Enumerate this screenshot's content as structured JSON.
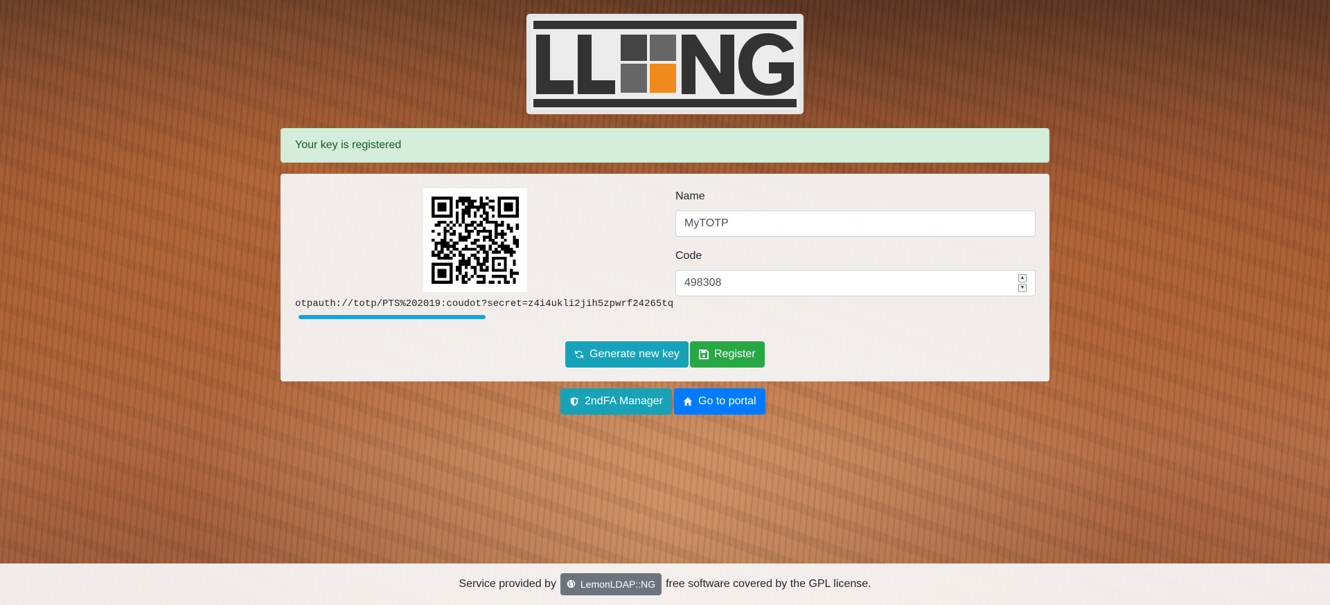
{
  "logo": {
    "text": "LLNG",
    "alt": "LemonLDAP::NG logo"
  },
  "alert": {
    "message": "Your key is registered"
  },
  "totp": {
    "otpauth_uri": "otpauth://totp/PTS%202019:coudot?secret=z4i4ukli2jih5zpwrf24265tq",
    "progress_fraction": 0.5
  },
  "form": {
    "name_label": "Name",
    "name_value": "MyTOTP",
    "code_label": "Code",
    "code_value": "498308"
  },
  "buttons": {
    "generate_label": "Generate new key",
    "register_label": "Register",
    "manager_label": "2ndFA Manager",
    "portal_label": "Go to portal"
  },
  "footer": {
    "prefix": "Service provided by",
    "badge_label": "LemonLDAP::NG",
    "suffix": "free software covered by the GPL license."
  },
  "colors": {
    "info": "#17a2b8",
    "success": "#28a745",
    "primary": "#007bff",
    "secondary": "#6c757d",
    "alert_bg": "#d4edda",
    "alert_text": "#155724",
    "logo_orange": "#f08a1c",
    "logo_dark": "#333333"
  },
  "icons": {
    "generate": "refresh-icon",
    "register": "floppy-disk-icon",
    "manager": "shield-icon",
    "portal": "home-icon",
    "footer_badge": "globe-icon"
  }
}
